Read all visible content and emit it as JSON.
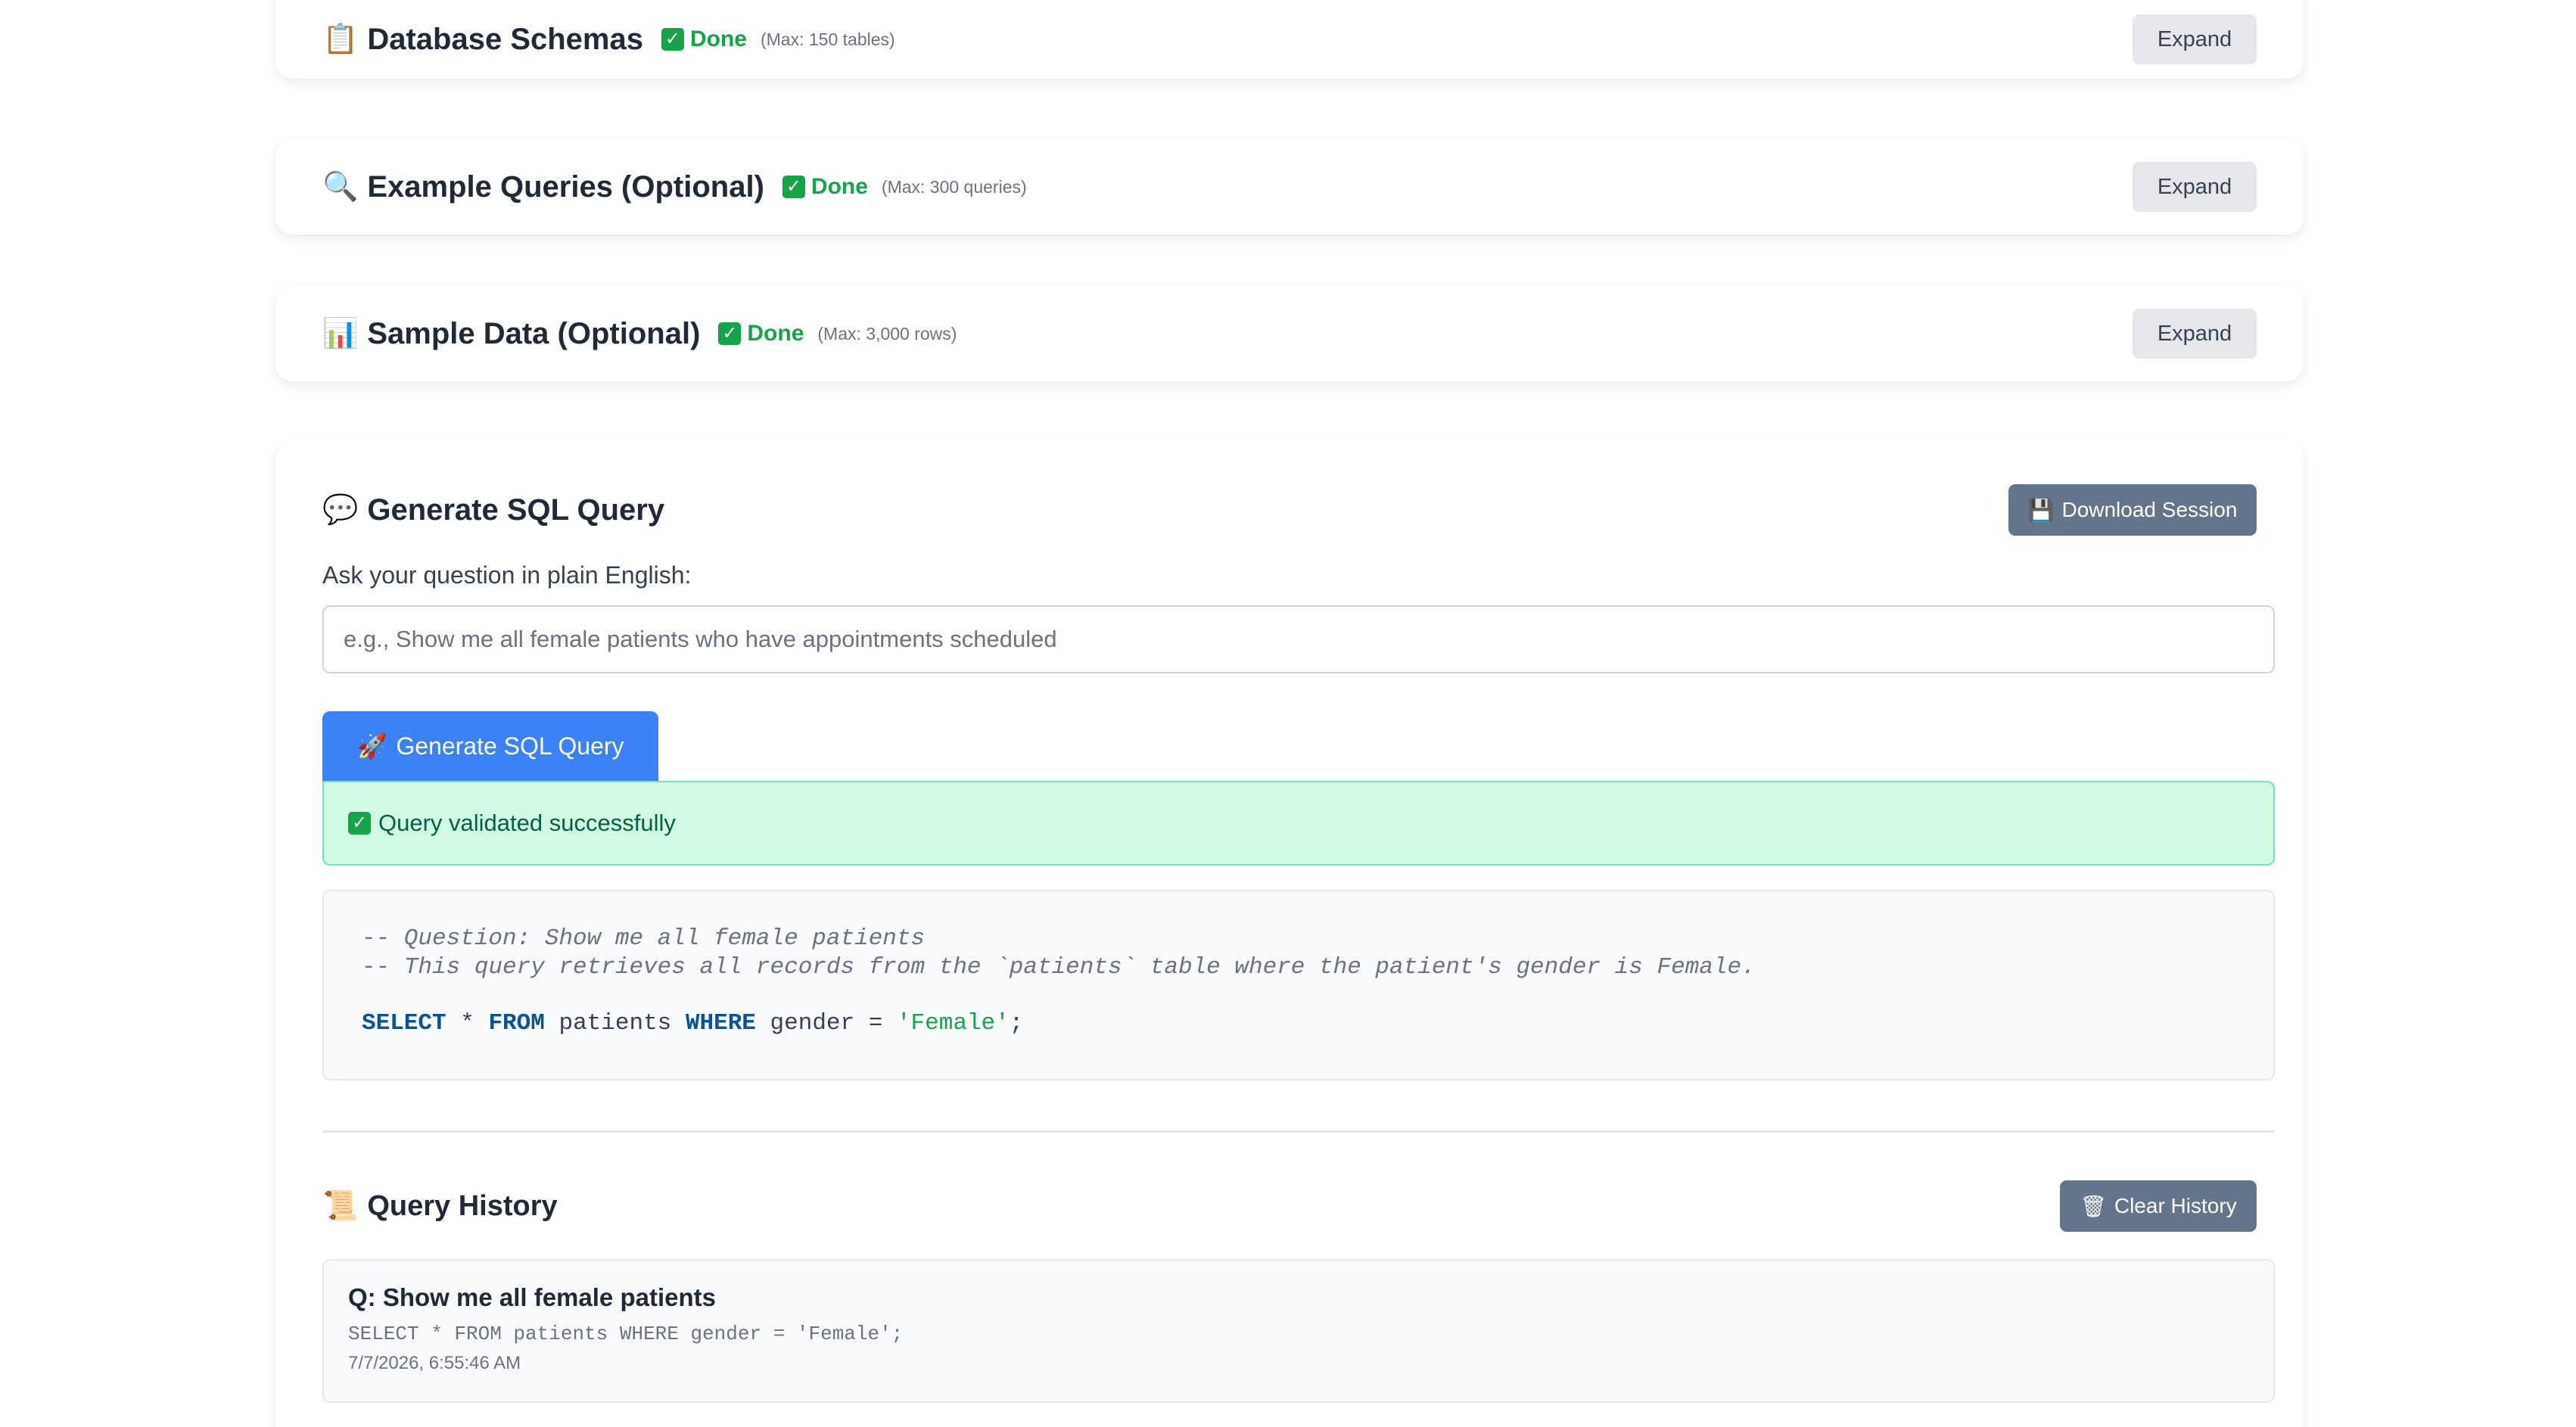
{
  "sections": [
    {
      "icon": "📋",
      "title": "Database Schemas",
      "status": "Done",
      "max_note": "(Max: 150 tables)",
      "button": "Expand"
    },
    {
      "icon": "🔍",
      "title": "Example Queries (Optional)",
      "status": "Done",
      "max_note": "(Max: 300 queries)",
      "button": "Expand"
    },
    {
      "icon": "📊",
      "title": "Sample Data (Optional)",
      "status": "Done",
      "max_note": "(Max: 3,000 rows)",
      "button": "Expand"
    }
  ],
  "generate": {
    "icon": "💬",
    "title": "Generate SQL Query",
    "download_icon": "💾",
    "download_label": "Download Session",
    "ask_label": "Ask your question in plain English:",
    "input_value": "",
    "input_placeholder": "e.g., Show me all female patients who have appointments scheduled",
    "button_icon": "🚀",
    "button_label": "Generate SQL Query",
    "success_message": "Query validated successfully"
  },
  "code": {
    "comment_1": "-- Question: Show me all female patients",
    "comment_2": "-- This query retrieves all records from the `patients` table where the patient's gender is Female.",
    "tokens": {
      "select": "SELECT",
      "star": " * ",
      "from": "FROM",
      "table": " patients ",
      "where": "WHERE",
      "cond": " gender = ",
      "value": "'Female'",
      "end": ";"
    }
  },
  "history": {
    "icon": "📜",
    "title": "Query History",
    "clear_icon": "🗑",
    "clear_label": "Clear History",
    "items": [
      {
        "question": "Q: Show me all female patients",
        "sql": "SELECT * FROM patients WHERE gender = 'Female';",
        "timestamp": "7/7/2026, 6:55:46 AM"
      }
    ]
  },
  "colors": {
    "accent": "#3b82f6",
    "success": "#16a34a",
    "success_bg": "#d1fae5",
    "secondary_button": "#64748b"
  }
}
